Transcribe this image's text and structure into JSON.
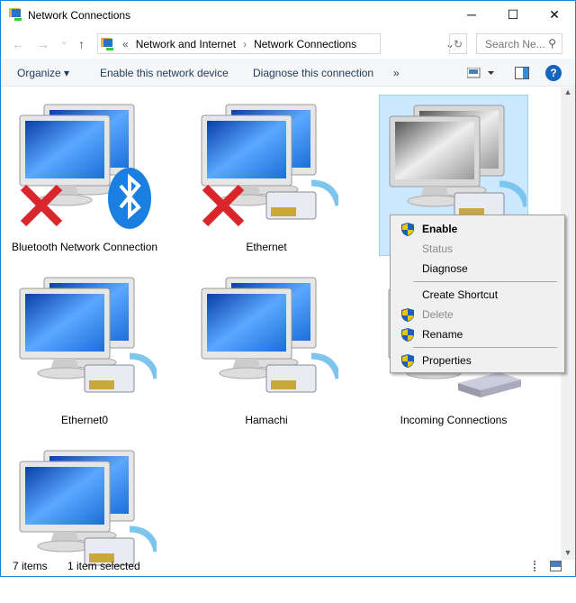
{
  "window": {
    "title": "Network Connections",
    "icon": "network-connections-icon",
    "minimize": "─",
    "maximize": "☐",
    "close": "✕"
  },
  "address": {
    "back": "←",
    "forward": "→",
    "recent": "⌄",
    "up": "↑",
    "prefix": "«",
    "crumbs": [
      "Network and Internet",
      "Network Connections"
    ],
    "separator": "›",
    "refresh": "↻",
    "dropdown": "⌄",
    "search_placeholder": "Search Ne...",
    "search_icon": "⚲"
  },
  "commands": {
    "organize": "Organize ▾",
    "enable": "Enable this network device",
    "diagnose": "Diagnose this connection",
    "more": "»",
    "help": "?"
  },
  "items": [
    {
      "label": "Bluetooth Network Connection",
      "disabled_x": true,
      "badge": "bluetooth",
      "selected": false,
      "grey": false
    },
    {
      "label": "Ethernet",
      "disabled_x": true,
      "badge": "ethernet",
      "selected": false,
      "grey": false
    },
    {
      "label": "",
      "disabled_x": false,
      "badge": "ethernet",
      "selected": true,
      "grey": true
    },
    {
      "label": "Ethernet0",
      "disabled_x": false,
      "badge": "ethernet",
      "selected": false,
      "grey": false
    },
    {
      "label": "Hamachi",
      "disabled_x": false,
      "badge": "ethernet",
      "selected": false,
      "grey": false
    },
    {
      "label": "Incoming Connections",
      "disabled_x": false,
      "badge": "modem",
      "selected": false,
      "grey": false
    },
    {
      "label": "",
      "disabled_x": false,
      "badge": "ethernet",
      "selected": false,
      "grey": false
    }
  ],
  "context_menu": [
    {
      "label": "Enable",
      "shield": true,
      "disabled": false,
      "bold": true
    },
    {
      "label": "Status",
      "shield": false,
      "disabled": true,
      "bold": false
    },
    {
      "label": "Diagnose",
      "shield": false,
      "disabled": false,
      "bold": false
    },
    {
      "label": "Create Shortcut",
      "shield": false,
      "disabled": false,
      "bold": false
    },
    {
      "label": "Delete",
      "shield": true,
      "disabled": true,
      "bold": false
    },
    {
      "label": "Rename",
      "shield": true,
      "disabled": false,
      "bold": false
    },
    {
      "label": "Properties",
      "shield": true,
      "disabled": false,
      "bold": false
    }
  ],
  "status": {
    "count": "7 items",
    "selected": "1 item selected"
  },
  "colors": {
    "accent": "#1883d7",
    "selection": "#cce8ff",
    "screen": "#1a6fd8"
  }
}
